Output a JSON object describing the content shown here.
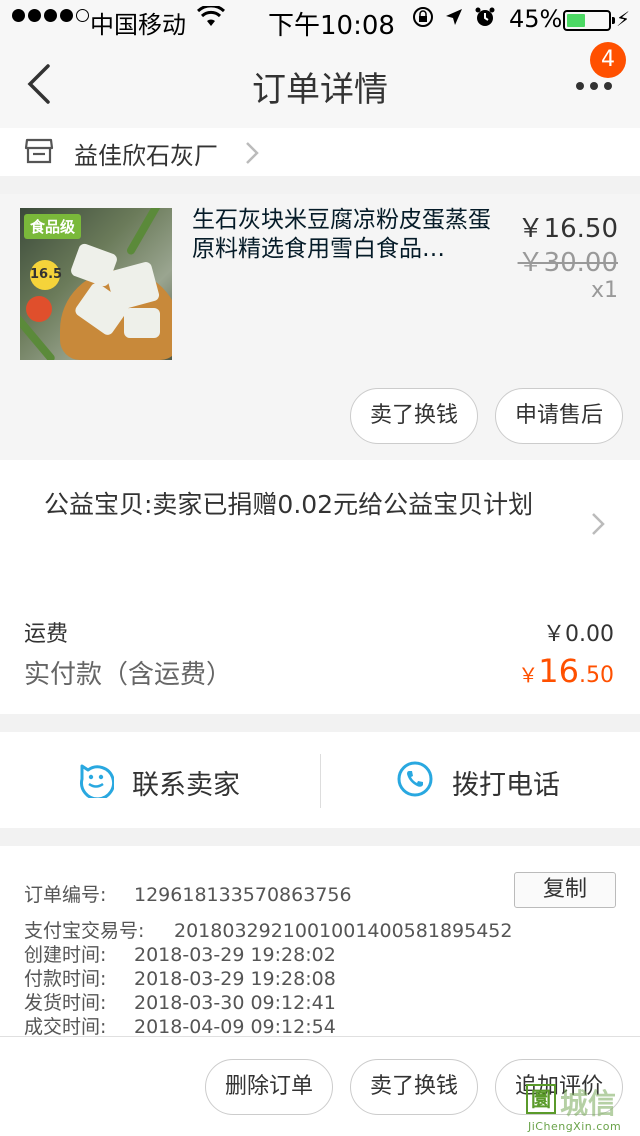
{
  "status_bar": {
    "carrier": "中国移动",
    "time": "下午10:08",
    "battery_percent": "45%",
    "battery_level": 0.45
  },
  "nav": {
    "title": "订单详情",
    "badge_count": "4"
  },
  "shop": {
    "name": "益佳欣石灰厂"
  },
  "item": {
    "title": "生石灰块米豆腐凉粉皮蛋蒸蛋原料精选食用雪白食品…",
    "image_tag": "食品级",
    "image_price": "16.5",
    "price": "￥16.50",
    "original_price": "￥30.00",
    "quantity": "x1",
    "actions": [
      "卖了换钱",
      "申请售后"
    ]
  },
  "charity": {
    "text": "公益宝贝:卖家已捐赠0.02元给公益宝贝计划"
  },
  "fees": {
    "shipping_label": "运费",
    "shipping_value": "￥0.00",
    "total_label": "实付款（含运费）",
    "total_currency": "￥",
    "total_integer": "16",
    "total_decimal": ".50"
  },
  "contact": {
    "seller_label": "联系卖家",
    "phone_label": "拨打电话"
  },
  "order_info": {
    "order_no_label": "订单编号:",
    "order_no": "129618133570863756",
    "copy_label": "复制",
    "alipay_label": "支付宝交易号:",
    "alipay_no": "2018032921001001400581895452",
    "created_label": "创建时间:",
    "created": "2018-03-29 19:28:02",
    "paid_label": "付款时间:",
    "paid": "2018-03-29 19:28:08",
    "shipped_label": "发货时间:",
    "shipped": "2018-03-30 09:12:41",
    "completed_label": "成交时间:",
    "completed": "2018-04-09 09:12:54"
  },
  "bottom_actions": [
    "删除订单",
    "卖了换钱",
    "追加评价"
  ],
  "watermark": {
    "box_char": "圜",
    "cn": "城信",
    "en": "JiChengXin.com"
  },
  "colors": {
    "accent": "#ff5000",
    "icon_blue": "#29a8e0",
    "battery_green": "#4cd964"
  }
}
